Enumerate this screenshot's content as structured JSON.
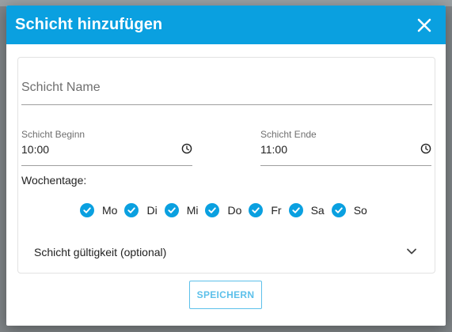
{
  "dialog": {
    "title": "Schicht hinzufügen",
    "close_icon": "close-icon"
  },
  "form": {
    "name_placeholder": "Schicht Name",
    "name_value": "",
    "start": {
      "label": "Schicht Beginn",
      "value": "10:00",
      "icon": "clock-icon"
    },
    "end": {
      "label": "Schicht Ende",
      "value": "11:00",
      "icon": "clock-icon"
    },
    "weekdays_label": "Wochentage:",
    "weekdays": [
      {
        "label": "Mo",
        "checked": true
      },
      {
        "label": "Di",
        "checked": true
      },
      {
        "label": "Mi",
        "checked": true
      },
      {
        "label": "Do",
        "checked": true
      },
      {
        "label": "Fr",
        "checked": true
      },
      {
        "label": "Sa",
        "checked": true
      },
      {
        "label": "So",
        "checked": true
      }
    ],
    "validity_label": "Schicht gültigkeit (optional)",
    "validity_icon": "chevron-down-icon"
  },
  "actions": {
    "save_label": "SPEICHERN"
  },
  "colors": {
    "accent": "#0aa0e0",
    "save_button": "#5cc0ea"
  }
}
